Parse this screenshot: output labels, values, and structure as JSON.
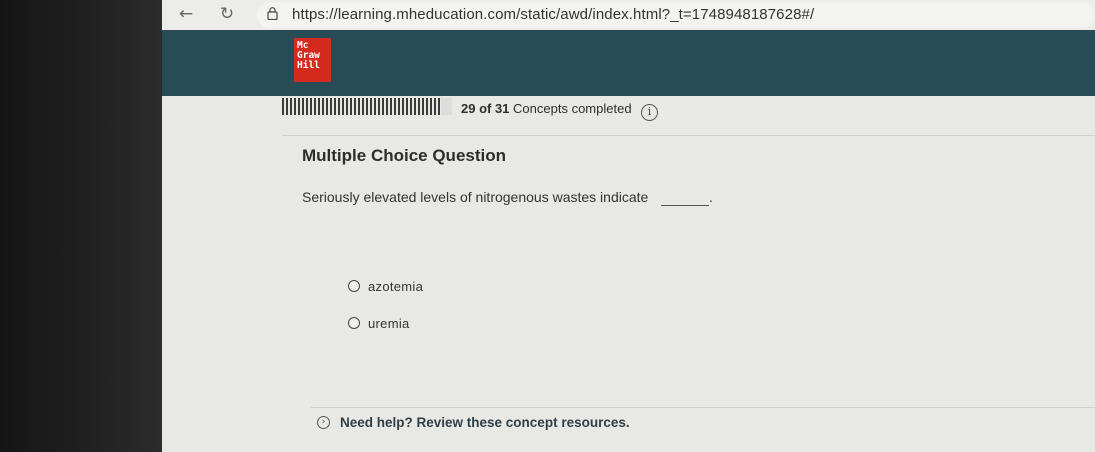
{
  "browser": {
    "back_icon": "arrow-left-icon",
    "reload_icon": "reload-icon",
    "url": "https://learning.mheducation.com/static/awd/index.html?_t=1748948187628#/"
  },
  "header": {
    "logo_line1": "Mc",
    "logo_line2": "Graw",
    "logo_line3": "Hill",
    "accent_color": "#284c55",
    "logo_color": "#d52b1e"
  },
  "progress": {
    "completed": 29,
    "total": 31,
    "fraction": 0.935,
    "count_text": "29 of 31",
    "suffix_text": " Concepts completed",
    "info_icon": "info-icon"
  },
  "question": {
    "heading": "Multiple Choice Question",
    "prompt": "Seriously elevated levels of nitrogenous wastes indicate",
    "prompt_end": "."
  },
  "options": [
    {
      "label": "azotemia",
      "selected": false
    },
    {
      "label": "uremia",
      "selected": false
    }
  ],
  "help": {
    "label": "Need help? Review these concept resources.",
    "icon": "chevron-right-icon"
  }
}
